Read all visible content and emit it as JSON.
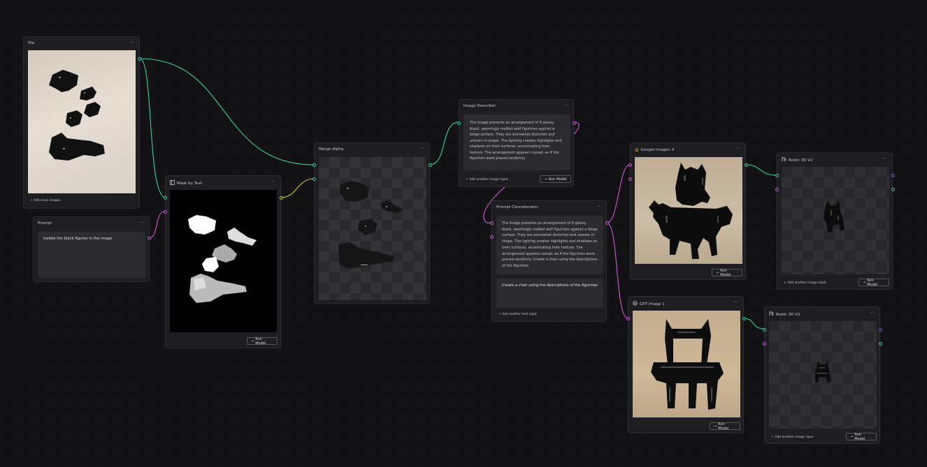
{
  "nodes": {
    "file": {
      "title": "File",
      "add_label": "+ Add more images"
    },
    "prompt": {
      "title": "Prompt",
      "text": "Isolate the black figures in the image"
    },
    "mask": {
      "title": "Mask by Text",
      "run_label": "Run Model"
    },
    "merge": {
      "title": "Merge Alpha"
    },
    "describer": {
      "title": "Image Describer",
      "text": "The image presents an arrangement of 6 glossy, black, seemingly melted wolf figurines against a beige surface. They are somewhat distorted and uneven in shape. The lighting creates highlights and shadows on their surfaces, accentuating their texture. The arrangement appears casual, as if the figurines were placed randomly.",
      "add_label": "Add another image input",
      "run_label": "Run Model"
    },
    "concat": {
      "title": "Prompt Concatenator",
      "text1": "The image presents an arrangement of 6 glossy, black, seemingly melted wolf figurines against a beige surface. They are somewhat distorted and uneven in shape. The lighting creates highlights and shadows on their surfaces, accentuating their texture. The arrangement appears casual, as if the figurines were placed randomly. Create a chair using the descriptions of the figurines",
      "text2": "Create a chair using the descriptions of the figurines",
      "add_label": "+ Add another text input"
    },
    "imagen": {
      "title": "Google Imagen 4",
      "run_label": "Run Model"
    },
    "gpt": {
      "title": "GPT Image 1",
      "run_label": "Run Model"
    },
    "rodin1": {
      "title": "Rodin 3D V2",
      "add_label": "Add another image input",
      "run_label": "Run Model"
    },
    "rodin2": {
      "title": "Rodin 3D V2",
      "add_label": "Add another image input",
      "run_label": "Run Model"
    }
  },
  "menu_glyph": "···",
  "colors": {
    "green_port": "#3fd19a",
    "pink_port": "#d45ad8",
    "blue_port": "#6a5ae0",
    "yellow_port": "#c8c83a",
    "background": "#121214"
  }
}
